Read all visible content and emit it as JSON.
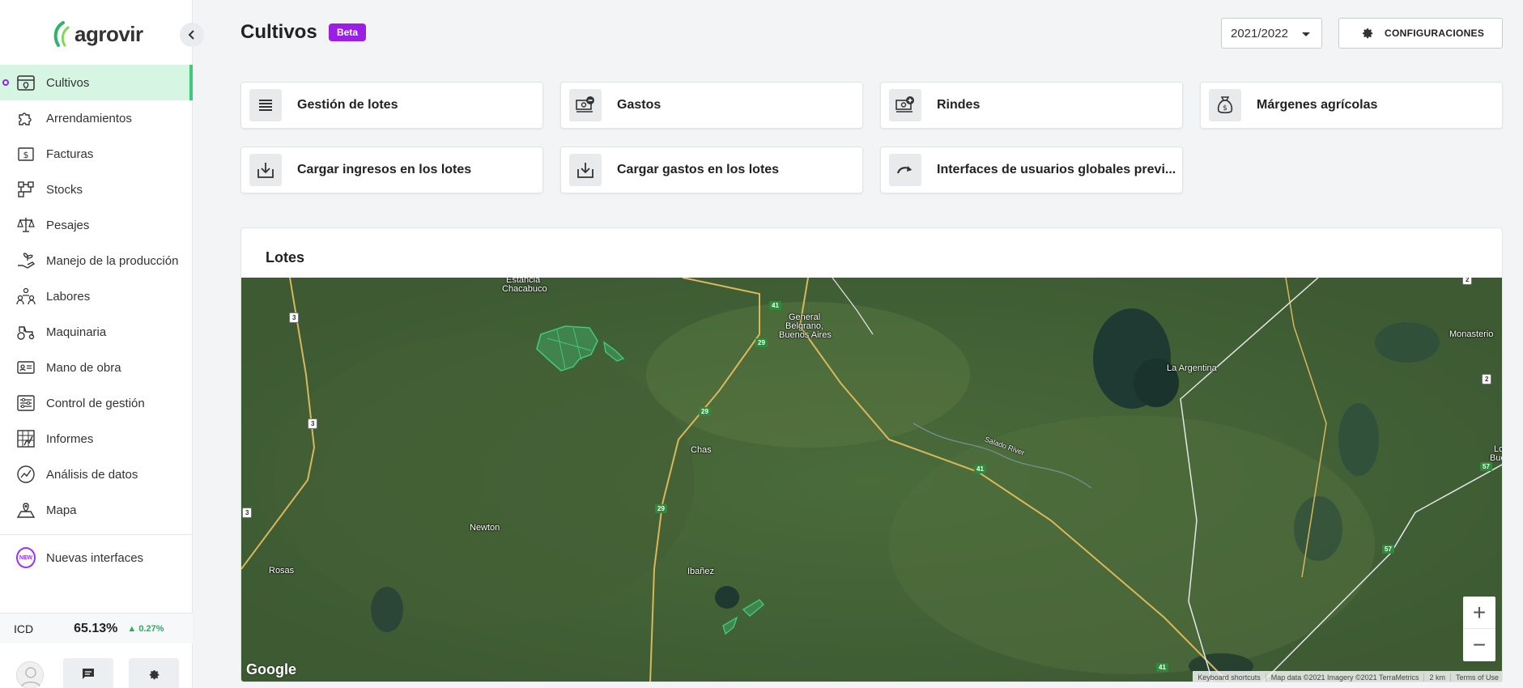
{
  "brand": {
    "logo_text": "agrovir"
  },
  "sidebar": {
    "items": [
      {
        "label": "Cultivos",
        "icon": "crop-calendar-icon",
        "active": true
      },
      {
        "label": "Arrendamientos",
        "icon": "puzzle-icon"
      },
      {
        "label": "Facturas",
        "icon": "invoice-dollar-icon"
      },
      {
        "label": "Stocks",
        "icon": "stock-flow-icon"
      },
      {
        "label": "Pesajes",
        "icon": "scale-icon"
      },
      {
        "label": "Manejo de la producción",
        "icon": "hand-plant-icon"
      },
      {
        "label": "Labores",
        "icon": "workers-icon"
      },
      {
        "label": "Maquinaria",
        "icon": "tractor-icon"
      },
      {
        "label": "Mano de obra",
        "icon": "id-card-icon"
      },
      {
        "label": "Control de gestión",
        "icon": "sliders-icon"
      },
      {
        "label": "Informes",
        "icon": "report-grid-icon"
      },
      {
        "label": "Análisis de datos",
        "icon": "chart-circle-icon"
      },
      {
        "label": "Mapa",
        "icon": "map-pin-icon"
      }
    ],
    "new_item": {
      "label": "Nuevas interfaces",
      "badge": "NEW"
    },
    "icd": {
      "label": "ICD",
      "value": "65.13%",
      "change": "0.27%"
    }
  },
  "header": {
    "title": "Cultivos",
    "badge": "Beta",
    "season": "2021/2022",
    "config_label": "CONFIGURACIONES"
  },
  "cards": [
    {
      "label": "Gestión de lotes",
      "icon": "list-icon"
    },
    {
      "label": "Gastos",
      "icon": "money-minus-icon"
    },
    {
      "label": "Rindes",
      "icon": "money-plus-icon"
    },
    {
      "label": "Márgenes agrícolas",
      "icon": "money-bag-icon"
    },
    {
      "label": "Cargar ingresos en los lotes",
      "icon": "download-tray-icon"
    },
    {
      "label": "Cargar gastos en los lotes",
      "icon": "download-tray-icon"
    },
    {
      "label": "Interfaces de usuarios globales previ...",
      "icon": "redo-arrow-icon"
    }
  ],
  "lotes": {
    "title": "Lotes",
    "map": {
      "places": [
        "Estancia",
        "Chacabuco",
        "General",
        "Belgrano,",
        "Buenos Aires",
        "La Argentina",
        "Monasterio",
        "Chas",
        "Newton",
        "Rosas",
        "Ibañez",
        "Salado River",
        "Lo",
        "Buen"
      ],
      "routes": [
        "3",
        "3",
        "3",
        "41",
        "29",
        "29",
        "29",
        "41",
        "41",
        "2",
        "2",
        "57",
        "57"
      ],
      "google": "Google",
      "attribution": [
        "Keyboard shortcuts",
        "Map data ©2021 Imagery ©2021 TerraMetrics",
        "2 km",
        "Terms of Use"
      ]
    }
  },
  "colors": {
    "accent_green": "#3ec97b",
    "beta_purple": "#9b1ee6",
    "active_bg": "#d6f5e2"
  }
}
